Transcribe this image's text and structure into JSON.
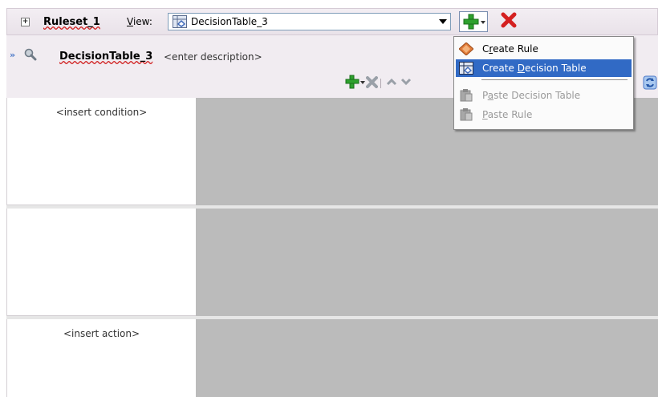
{
  "ruleset": {
    "expander": "+",
    "name": "Ruleset_1",
    "view_label_u": "V",
    "view_label_rest": "iew:",
    "view_selected": "DecisionTable_3"
  },
  "decision_table": {
    "collapse_glyph": "»",
    "name": "DecisionTable_3",
    "description": "<enter description>"
  },
  "grid": {
    "condition_placeholder": "<insert condition>",
    "action_placeholder": "<insert action>"
  },
  "add_menu": {
    "items": [
      {
        "pre": "C",
        "mn": "r",
        "post": "eate Rule",
        "icon": "rule-diamond-icon",
        "state": "normal"
      },
      {
        "pre": "Create ",
        "mn": "D",
        "post": "ecision Table",
        "icon": "decision-table-icon",
        "state": "active"
      },
      {
        "pre": "P",
        "mn": "a",
        "post": "ste Decision Table",
        "icon": "paste-icon",
        "state": "disabled"
      },
      {
        "pre": "",
        "mn": "P",
        "post": "aste Rule",
        "icon": "paste-icon",
        "state": "disabled"
      }
    ]
  },
  "colors": {
    "menu_highlight": "#316ac5",
    "add_green": "#2ea12e",
    "delete_red": "#d42020",
    "grid_gray": "#bbbbbb"
  }
}
